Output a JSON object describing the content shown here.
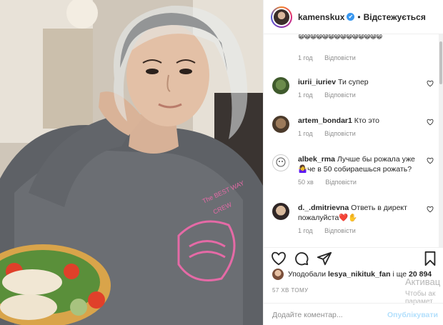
{
  "photo": {
    "print_text": "The BEST WAY",
    "print_text2": "CREW"
  },
  "header": {
    "username": "kamenskux",
    "verified_mark": "✔",
    "separator": "•",
    "follow_label": "Відстежується"
  },
  "comments": [
    {
      "user": "",
      "text": "😁😁😁😁😁😁😁😁😁😁😁😁😁😁",
      "time": "1 год",
      "reply": "Відповісти"
    },
    {
      "user": "iurii_iuriev",
      "text": "Ти супер",
      "time": "1 год",
      "reply": "Відповісти"
    },
    {
      "user": "artem_bondar1",
      "text": "Кто это",
      "time": "1 год",
      "reply": "Відповісти"
    },
    {
      "user": "albek_rma",
      "text": "Лучше бы рожала уже 🤷‍♀️че в 50 собираешься рожать?",
      "time": "50 хв",
      "reply": "Відповісти"
    },
    {
      "user": "d._.dmitrievna",
      "text": "Ответь в директ пожалуйста❤️✋",
      "time": "1 год",
      "reply": "Відповісти"
    }
  ],
  "likes": {
    "prefix": "Уподобали",
    "user": "lesya_nikituk_fan",
    "connector": "і ще",
    "count": "20 894"
  },
  "post_time": "57 ХВ ТОМУ",
  "add_comment": {
    "placeholder": "Додайте коментар...",
    "post_label": "Опублікувати"
  },
  "watermark": {
    "line1": "Активац",
    "line2": "Чтобы ак",
    "line3": "парамет"
  }
}
